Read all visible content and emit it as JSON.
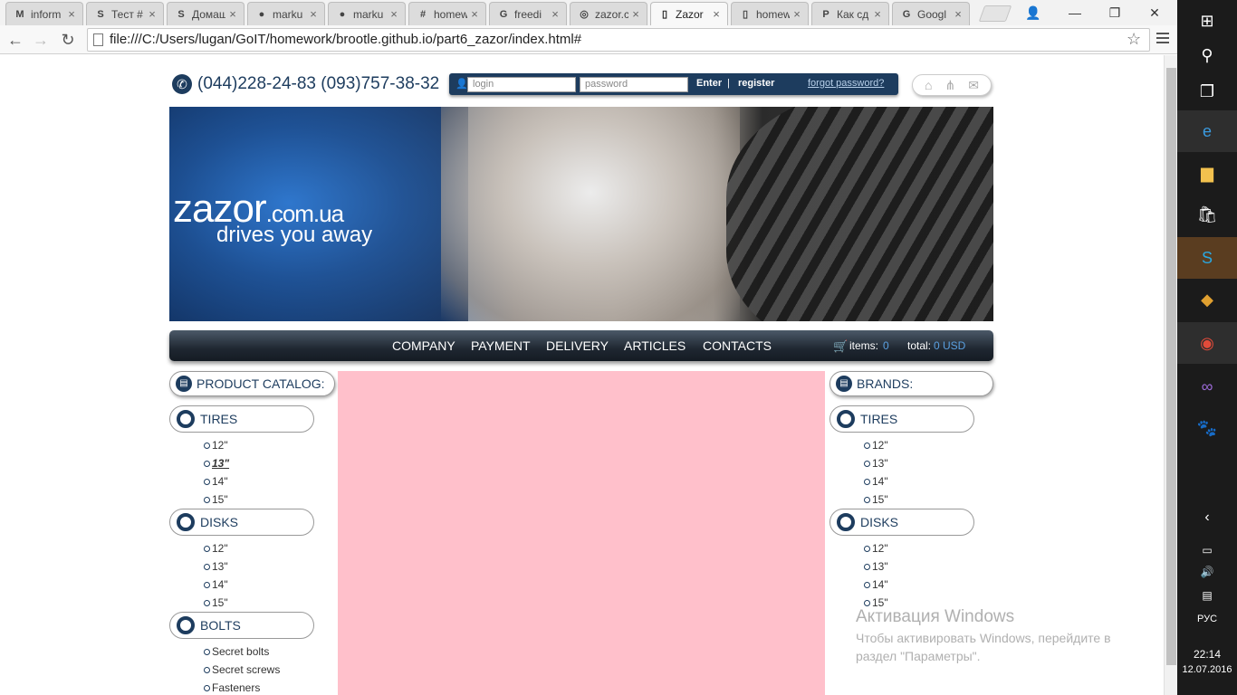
{
  "browser": {
    "tabs": [
      {
        "label": "inform",
        "icon": "gmail-icon",
        "glyph": "M"
      },
      {
        "label": "Тест #",
        "icon": "skype-icon",
        "glyph": "S"
      },
      {
        "label": "Домаш",
        "icon": "skype-icon",
        "glyph": "S"
      },
      {
        "label": "marku",
        "icon": "github-icon",
        "glyph": "●"
      },
      {
        "label": "marku",
        "icon": "github-icon",
        "glyph": "●"
      },
      {
        "label": "homew",
        "icon": "hash-icon",
        "glyph": "#"
      },
      {
        "label": "freedi",
        "icon": "google-icon",
        "glyph": "G"
      },
      {
        "label": "zazor.c",
        "icon": "zazor-icon",
        "glyph": "◎"
      },
      {
        "label": "Zazor",
        "icon": "page-icon",
        "glyph": "▯",
        "active": true
      },
      {
        "label": "homew",
        "icon": "page-icon",
        "glyph": "▯"
      },
      {
        "label": "Как сд",
        "icon": "p-icon",
        "glyph": "P"
      },
      {
        "label": "Googl",
        "icon": "google-translate-icon",
        "glyph": "G"
      }
    ],
    "address": "file:///C:/Users/lugan/GoIT/homework/brootle.github.io/part6_zazor/index.html#"
  },
  "header": {
    "phones": "(044)228-24-83 (093)757-38-32",
    "login_placeholder": "login",
    "password_placeholder": "password",
    "enter": "Enter",
    "separator": "|",
    "register": "register",
    "forgot": "forgot password?"
  },
  "banner": {
    "logo_main": "zazor",
    "logo_domain": ".com.ua",
    "tagline": "drives you away"
  },
  "nav": {
    "items": [
      "COMPANY",
      "PAYMENT",
      "DELIVERY",
      "ARTICLES",
      "CONTACTS"
    ],
    "items_label": "items:",
    "items_count": "0",
    "total_label": "total:",
    "total_value": "0 USD"
  },
  "catalog": {
    "title": "PRODUCT CATALOG:",
    "tires": {
      "label": "TIRES",
      "items": [
        "12\"",
        "13\"",
        "14\"",
        "15\""
      ]
    },
    "disks": {
      "label": "DISKS",
      "items": [
        "12\"",
        "13\"",
        "14\"",
        "15\""
      ]
    },
    "bolts": {
      "label": "BOLTS",
      "items": [
        "Secret bolts",
        "Secret screws",
        "Fasteners"
      ]
    }
  },
  "brands": {
    "title": "BRANDS:",
    "tires": {
      "label": "TIRES",
      "items": [
        "12\"",
        "13\"",
        "14\"",
        "15\""
      ]
    },
    "disks": {
      "label": "DISKS",
      "items": [
        "12\"",
        "13\"",
        "14\"",
        "15\""
      ]
    }
  },
  "watermark": {
    "title": "Активация Windows",
    "line1": "Чтобы активировать Windows, перейдите в",
    "line2": "раздел \"Параметры\"."
  },
  "taskbar": {
    "lang": "РУС",
    "time": "22:14",
    "date": "12.07.2016"
  },
  "colors": {
    "brand": "#1d3c5e",
    "accent": "#5aa0e0",
    "content": "#ffc0cb"
  }
}
